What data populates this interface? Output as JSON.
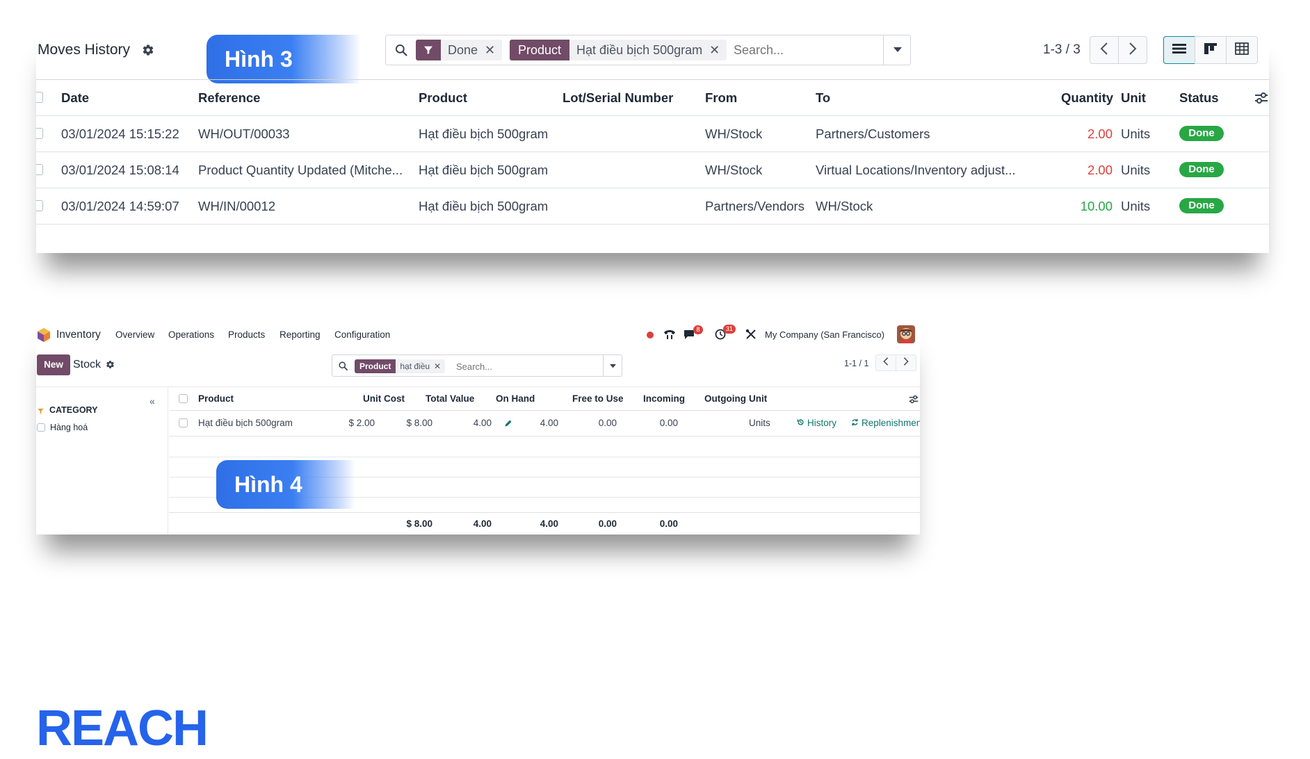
{
  "moves": {
    "title": "Moves History",
    "badge": "Hình 3",
    "filters": {
      "done": "Done",
      "product_facet": "Product",
      "product_value": "Hạt điều bịch 500gram"
    },
    "search_placeholder": "Search...",
    "pager": "1-3 / 3",
    "columns": [
      "Date",
      "Reference",
      "Product",
      "Lot/Serial Number",
      "From",
      "To",
      "Quantity",
      "Unit",
      "Status"
    ],
    "rows": [
      {
        "date": "03/01/2024 15:15:22",
        "reference": "WH/OUT/00033",
        "product": "Hạt điều bịch 500gram",
        "lot": "",
        "from": "WH/Stock",
        "to": "Partners/Customers",
        "quantity": "2.00",
        "unit": "Units",
        "status": "Done"
      },
      {
        "date": "03/01/2024 15:08:14",
        "reference": "Product Quantity Updated (Mitche...",
        "product": "Hạt điều bịch 500gram",
        "lot": "",
        "from": "WH/Stock",
        "to": "Virtual Locations/Inventory adjust...",
        "quantity": "2.00",
        "unit": "Units",
        "status": "Done"
      },
      {
        "date": "03/01/2024 14:59:07",
        "reference": "WH/IN/00012",
        "product": "Hạt điều bịch 500gram",
        "lot": "",
        "from": "Partners/Vendors",
        "to": "WH/Stock",
        "quantity": "10.00",
        "unit": "Units",
        "status": "Done"
      }
    ]
  },
  "stock": {
    "badge": "Hình 4",
    "app_name": "Inventory",
    "menu": [
      "Overview",
      "Operations",
      "Products",
      "Reporting",
      "Configuration"
    ],
    "chat_count": "8",
    "activity_count": "31",
    "company": "My Company (San Francisco)",
    "new_label": "New",
    "title": "Stock",
    "filter_facet": "Product",
    "filter_value": "hạt điều",
    "search_placeholder": "Search...",
    "pager": "1-1 / 1",
    "category_label": "CATEGORY",
    "category_items": [
      "Hàng hoá"
    ],
    "columns": [
      "Product",
      "Unit Cost",
      "Total Value",
      "On Hand",
      "Free to Use",
      "Incoming",
      "Outgoing",
      "Unit"
    ],
    "row": {
      "product": "Hạt điều bịch 500gram",
      "unit_cost": "$ 2.00",
      "total_value": "$ 8.00",
      "on_hand": "4.00",
      "free_to_use": "4.00",
      "incoming": "0.00",
      "outgoing": "0.00",
      "unit": "Units",
      "history": "History",
      "replenishment": "Replenishment"
    },
    "totals": {
      "total_value": "$ 8.00",
      "on_hand": "4.00",
      "free_to_use": "4.00",
      "incoming": "0.00",
      "outgoing": "0.00"
    }
  },
  "brand": "REACH",
  "colors": {
    "accent": "#714b67",
    "badge_blue": "#3a7ff2",
    "done_green": "#28a745",
    "negative_red": "#d9413b",
    "brand_blue": "#2563eb"
  }
}
